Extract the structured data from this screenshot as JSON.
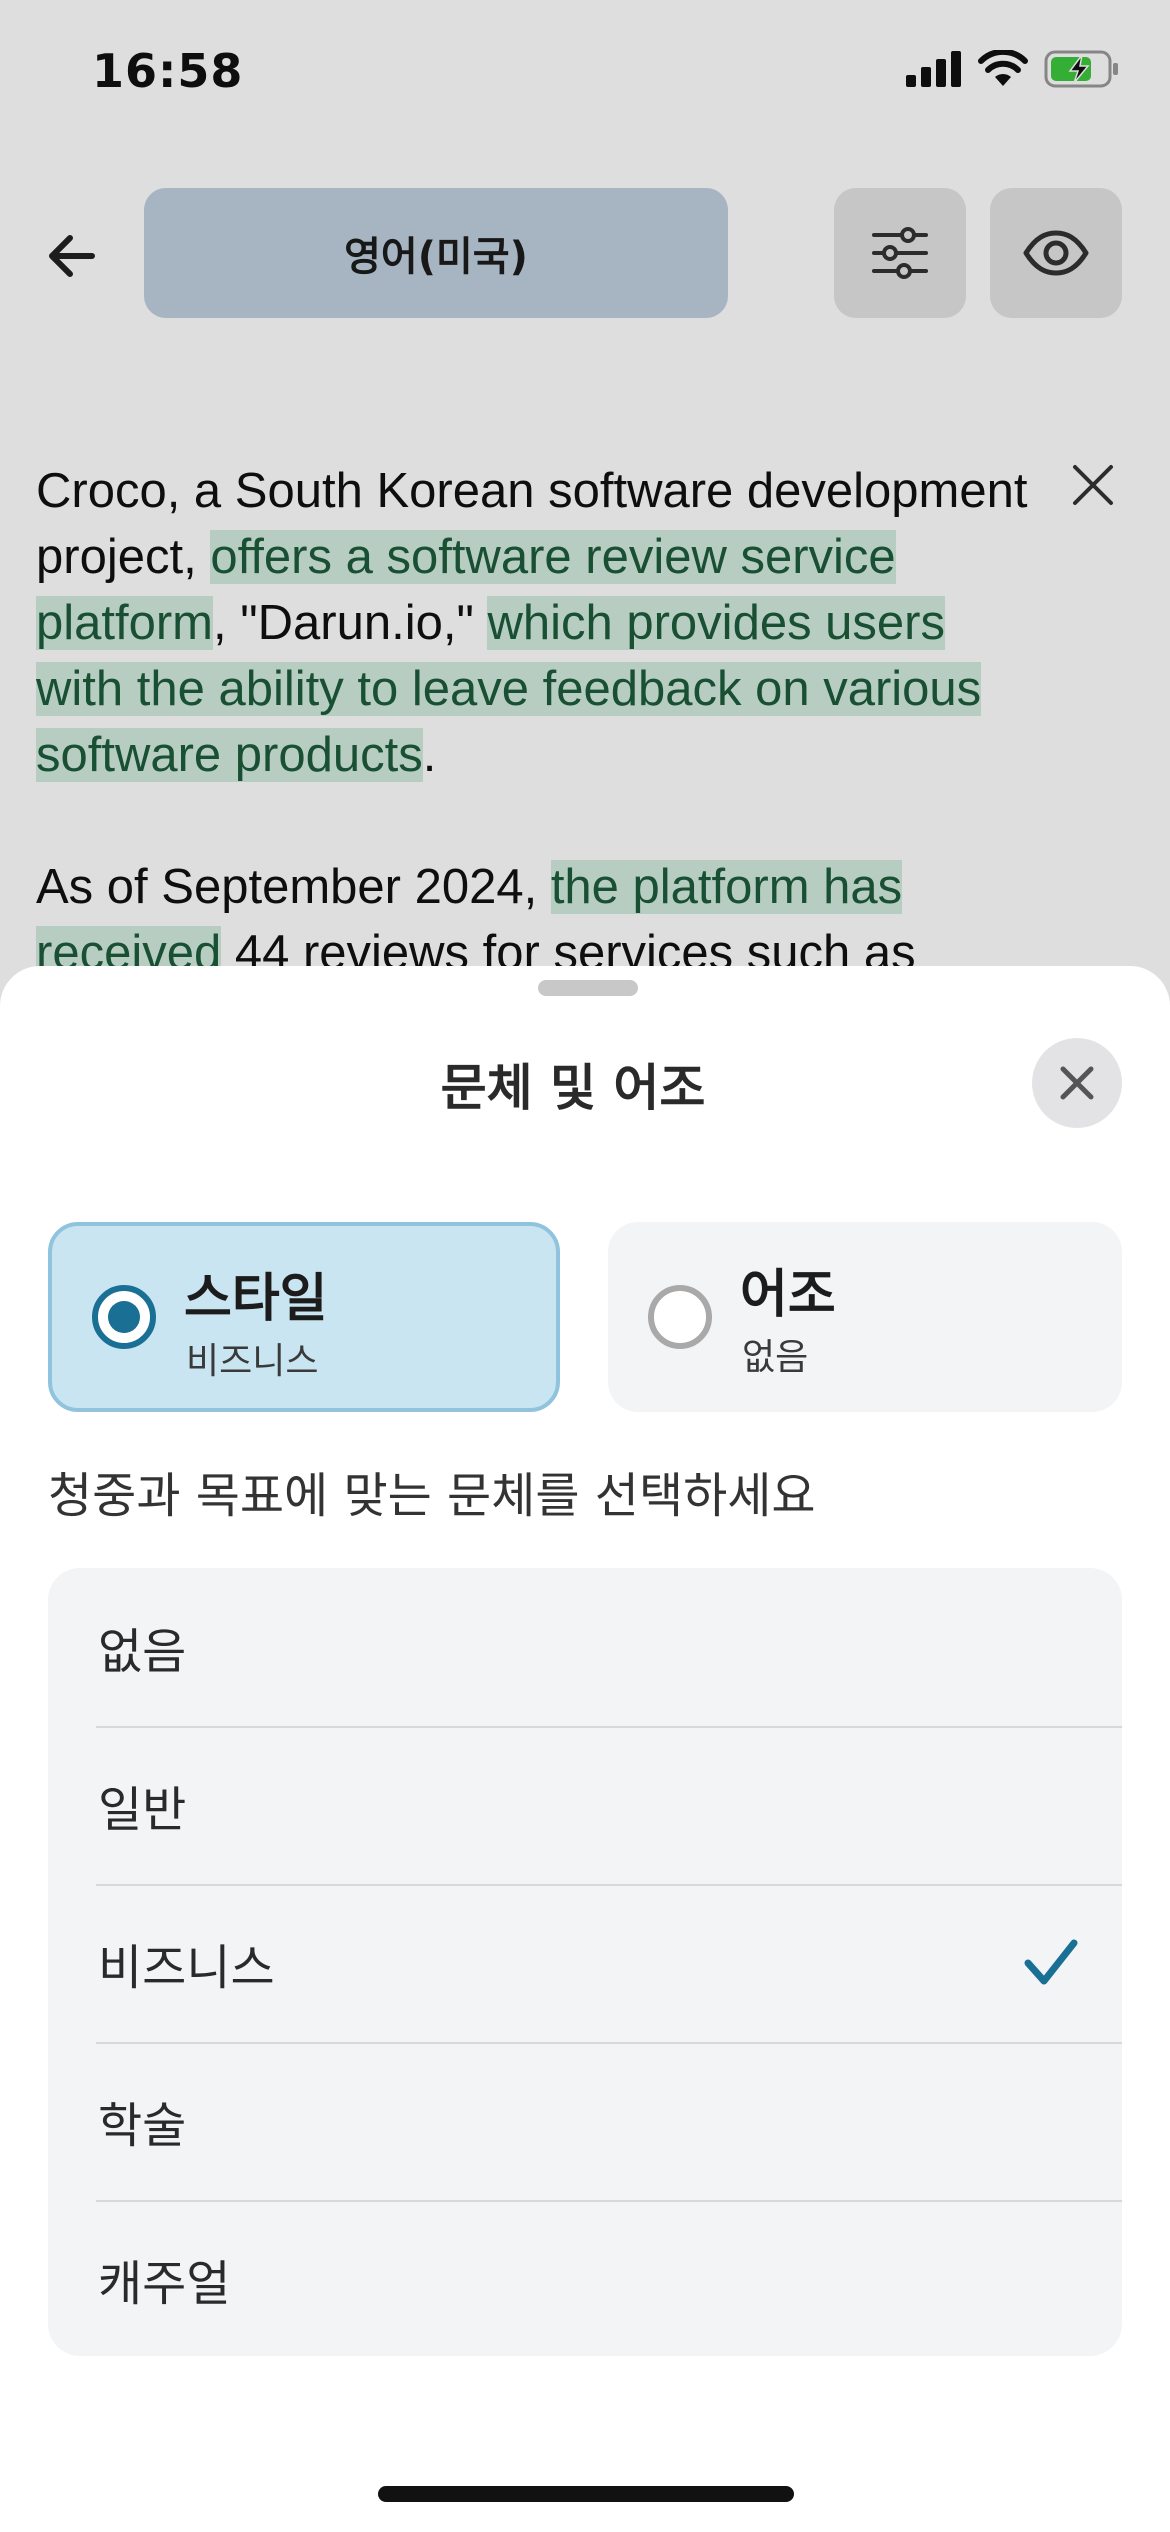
{
  "status_bar": {
    "time": "16:58"
  },
  "toolbar": {
    "back_icon": "arrow-left-icon",
    "language_label": "영어(미국)",
    "settings_icon": "sliders-icon",
    "eye_icon": "eye-icon"
  },
  "content": {
    "paragraph_1": {
      "plain_1": "Croco, a South Korean software development project, ",
      "highlight_1": "offers a software review service platform",
      "plain_2": ", \"Darun.io,\" ",
      "highlight_2": "which provides users with the ability to leave feedback on various software products",
      "plain_3": "."
    },
    "paragraph_2": {
      "plain_1": "As of September 2024, ",
      "highlight_1": "the platform has received",
      "plain_2": " 44 reviews for services such as"
    },
    "clear_icon": "close-icon"
  },
  "sheet": {
    "title": "문체 및 어조",
    "close_icon": "close-icon",
    "segments": {
      "style": {
        "title": "스타일",
        "value": "비즈니스",
        "selected": true
      },
      "tone": {
        "title": "어조",
        "value": "없음",
        "selected": false
      }
    },
    "hint": "청중과 목표에 맞는 문체를 선택하세요",
    "options": [
      {
        "label": "없음",
        "selected": false
      },
      {
        "label": "일반",
        "selected": false
      },
      {
        "label": "비즈니스",
        "selected": true
      },
      {
        "label": "학술",
        "selected": false
      },
      {
        "label": "캐주얼",
        "selected": false
      }
    ]
  },
  "colors": {
    "accent": "#1a6f94",
    "highlight_bg": "#d3ecde",
    "highlight_text": "#1d5b3b",
    "segment_selected_bg": "#c9e5f2"
  }
}
